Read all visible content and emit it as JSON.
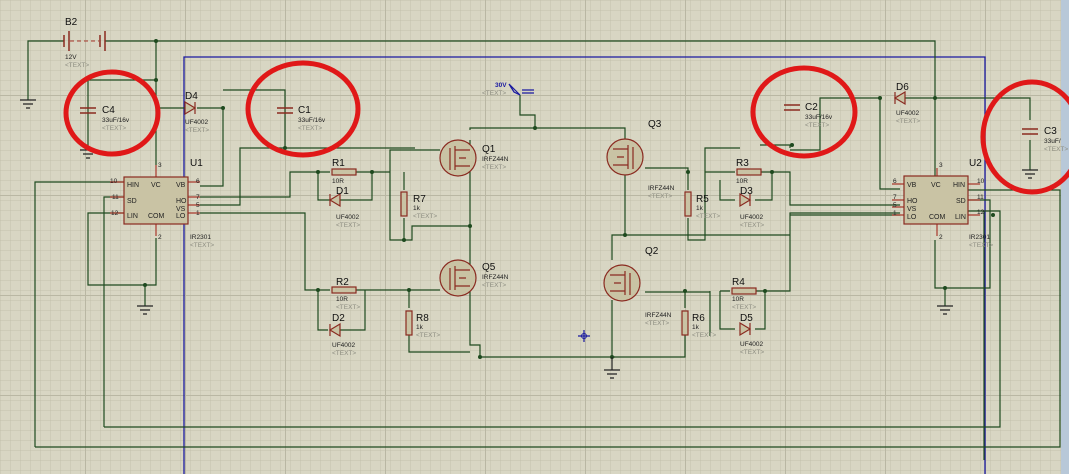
{
  "app": "Proteus ISIS schematic",
  "colors": {
    "background": "#d8d6c3",
    "wire": "#1f4a1f",
    "component_outline": "#8a2a20",
    "sheet_border": "#1a1aa0",
    "highlight_circles": "#e01818"
  },
  "placeholder_text": "<TEXT>",
  "components": {
    "B2": {
      "ref": "B2",
      "value": "12V"
    },
    "C4": {
      "ref": "C4",
      "value": "33uF/16v"
    },
    "C1": {
      "ref": "C1",
      "value": "33uF/16v"
    },
    "C2": {
      "ref": "C2",
      "value": "33uF/16v"
    },
    "C3": {
      "ref": "C3",
      "value": "33uF/"
    },
    "D1": {
      "ref": "D1",
      "value": "UF4002"
    },
    "D2": {
      "ref": "D2",
      "value": "UF4002"
    },
    "D3": {
      "ref": "D3",
      "value": "UF4002"
    },
    "D4": {
      "ref": "D4",
      "value": "UF4002"
    },
    "D5": {
      "ref": "D5",
      "value": "UF4002"
    },
    "D6": {
      "ref": "D6",
      "value": "UF4002"
    },
    "R1": {
      "ref": "R1",
      "value": "10R"
    },
    "R2": {
      "ref": "R2",
      "value": "10R"
    },
    "R3": {
      "ref": "R3",
      "value": "10R"
    },
    "R4": {
      "ref": "R4",
      "value": "10R"
    },
    "R5": {
      "ref": "R5",
      "value": "1k"
    },
    "R6": {
      "ref": "R6",
      "value": "1k"
    },
    "R7": {
      "ref": "R7",
      "value": "1k"
    },
    "R8": {
      "ref": "R8",
      "value": "1k"
    },
    "Q1": {
      "ref": "Q1",
      "value": "IRFZ44N"
    },
    "Q2": {
      "ref": "Q2",
      "value": "IRFZ44N"
    },
    "Q3": {
      "ref": "Q3",
      "value": "IRFZ44N"
    },
    "Q5": {
      "ref": "Q5",
      "value": "IRFZ44N"
    },
    "U1": {
      "ref": "U1",
      "value": "IR2301"
    },
    "U2": {
      "ref": "U2",
      "value": "IR2301"
    },
    "V30": {
      "value": "30V"
    }
  },
  "ic_pins": {
    "HIN": "HIN",
    "SD": "SD",
    "LIN": "LIN",
    "VC": "VC",
    "COM": "COM",
    "VB": "VB",
    "HO": "HO",
    "VS": "VS",
    "LO": "LO",
    "n10": "10",
    "n11": "11",
    "n12": "12",
    "n3": "3",
    "n2": "2",
    "n6": "6",
    "n7": "7",
    "n5": "5",
    "n1": "1"
  }
}
